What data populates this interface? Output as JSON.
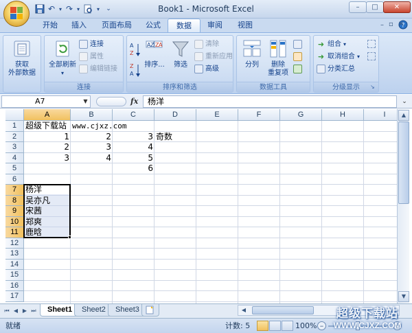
{
  "window": {
    "title": "Book1 - Microsoft Excel",
    "controls": {
      "minimize": "–",
      "restore": "□",
      "close": "✕"
    }
  },
  "quick_access": {
    "icons": [
      "save-icon",
      "undo-icon",
      "redo-icon",
      "print-preview-icon",
      "customize-dropdown-icon"
    ]
  },
  "ribbon": {
    "tabs": [
      "开始",
      "插入",
      "页面布局",
      "公式",
      "数据",
      "审阅",
      "视图"
    ],
    "active_tab": "数据",
    "groups": {
      "get_external": {
        "label_line1": "获取",
        "label_line2": "外部数据",
        "group_label": ""
      },
      "connections": {
        "group_label": "连接",
        "refresh_all": "全部刷新",
        "connections": "连接",
        "properties": "属性",
        "edit_links": "编辑链接"
      },
      "sort_filter": {
        "group_label": "排序和筛选",
        "sort_az": "A↓Z",
        "sort_za": "Z↓A",
        "sort": "排序...",
        "filter": "筛选",
        "clear": "清除",
        "reapply": "重新应用",
        "advanced": "高级"
      },
      "data_tools": {
        "group_label": "数据工具",
        "text_to_columns": "分列",
        "remove_dup_line1": "删除",
        "remove_dup_line2": "重复项"
      },
      "outline": {
        "group_label": "分级显示",
        "group": "组合",
        "ungroup": "取消组合",
        "subtotal": "分类汇总"
      }
    }
  },
  "formula_bar": {
    "name_box": "A7",
    "fx": "fx",
    "value": "杨洋"
  },
  "grid": {
    "columns": [
      "A",
      "B",
      "C",
      "D",
      "E",
      "F",
      "G",
      "H",
      "I"
    ],
    "rows": [
      "1",
      "2",
      "3",
      "4",
      "5",
      "6",
      "7",
      "8",
      "9",
      "10",
      "11",
      "12",
      "13",
      "14",
      "15",
      "16",
      "17"
    ],
    "selected_column": "A",
    "selected_rows": [
      "7",
      "8",
      "9",
      "10",
      "11"
    ],
    "cells": {
      "A1": "超级下载站",
      "B1": "www.cjxz.com",
      "A2": "1",
      "B2": "2",
      "C2": "3",
      "D2": "奇数",
      "A3": "2",
      "B3": "3",
      "C3": "4",
      "A4": "3",
      "B4": "4",
      "C4": "5",
      "C5": "6",
      "A7": "杨洋",
      "A8": "吴亦凡",
      "A9": "宋茜",
      "A10": "郑爽",
      "A11": "鹿晗"
    }
  },
  "sheets": {
    "tabs": [
      "Sheet1",
      "Sheet2",
      "Sheet3"
    ],
    "active": "Sheet1"
  },
  "status": {
    "ready": "就绪",
    "count": "计数: 5",
    "zoom": "100%"
  },
  "watermark": {
    "top": "超级下载站",
    "bottom": "WWW.CJXZ.COM"
  },
  "colors": {
    "ribbon_bg": "#dbe8f8",
    "selected_header": "#f1c15f",
    "selection_fill": "#c4d0ec",
    "text_blue": "#15428b"
  }
}
